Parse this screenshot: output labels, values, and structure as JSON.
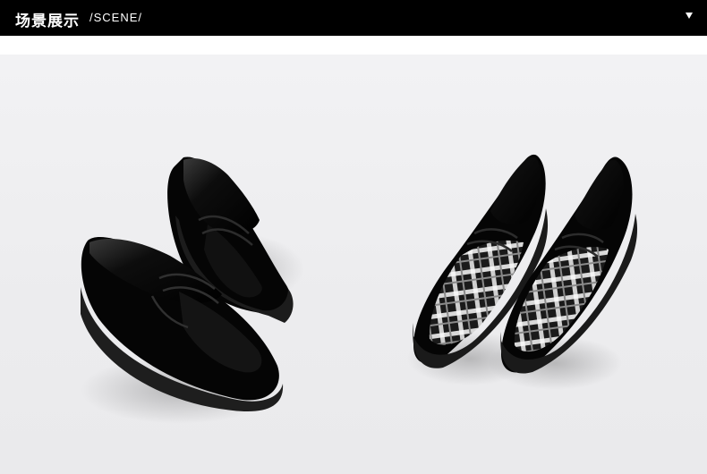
{
  "header": {
    "title_cn": "场景展示",
    "title_en": "/SCENE/"
  },
  "icons": {
    "toggle": "caret-down-icon"
  },
  "colors": {
    "header_bg": "#000000",
    "header_text": "#ffffff",
    "scene_bg": "#efeff1",
    "shoe_leather": "#0a0a0a",
    "plaid_light": "#e6e6e6"
  }
}
